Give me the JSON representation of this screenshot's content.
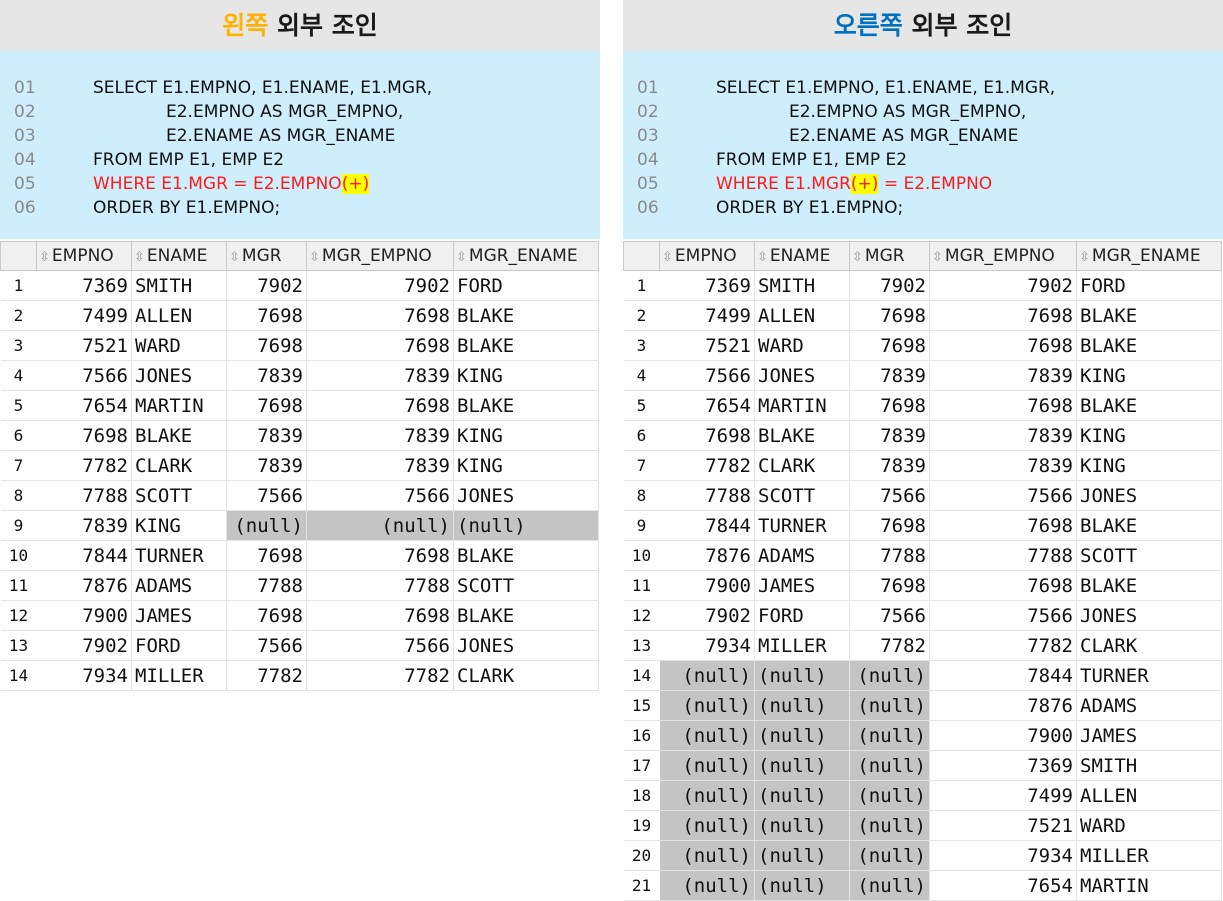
{
  "left": {
    "title_highlight": "왼쪽",
    "title_rest": " 외부 조인",
    "title_color": "#ffb100",
    "code": [
      {
        "ln": "01",
        "indent": 0,
        "red": false,
        "text": "SELECT E1.EMPNO, E1.ENAME, E1.MGR,",
        "hl": ""
      },
      {
        "ln": "02",
        "indent": 1,
        "red": false,
        "text": "E2.EMPNO AS MGR_EMPNO,",
        "hl": ""
      },
      {
        "ln": "03",
        "indent": 1,
        "red": false,
        "text": "E2.ENAME AS MGR_ENAME",
        "hl": ""
      },
      {
        "ln": "04",
        "indent": 0,
        "red": false,
        "text": "FROM EMP E1, EMP E2",
        "hl": ""
      },
      {
        "ln": "05",
        "indent": 0,
        "red": true,
        "text": "WHERE E1.MGR = E2.EMPNO",
        "hl": "(+)",
        "after": ""
      },
      {
        "ln": "06",
        "indent": 0,
        "red": false,
        "text": "ORDER BY E1.EMPNO;",
        "hl": ""
      }
    ],
    "columns": [
      "EMPNO",
      "ENAME",
      "MGR",
      "MGR_EMPNO",
      "MGR_ENAME"
    ],
    "rows": [
      [
        "1",
        "7369",
        "SMITH",
        "7902",
        "7902",
        "FORD"
      ],
      [
        "2",
        "7499",
        "ALLEN",
        "7698",
        "7698",
        "BLAKE"
      ],
      [
        "3",
        "7521",
        "WARD",
        "7698",
        "7698",
        "BLAKE"
      ],
      [
        "4",
        "7566",
        "JONES",
        "7839",
        "7839",
        "KING"
      ],
      [
        "5",
        "7654",
        "MARTIN",
        "7698",
        "7698",
        "BLAKE"
      ],
      [
        "6",
        "7698",
        "BLAKE",
        "7839",
        "7839",
        "KING"
      ],
      [
        "7",
        "7782",
        "CLARK",
        "7839",
        "7839",
        "KING"
      ],
      [
        "8",
        "7788",
        "SCOTT",
        "7566",
        "7566",
        "JONES"
      ],
      [
        "9",
        "7839",
        "KING",
        "(null)",
        "(null)",
        "(null)"
      ],
      [
        "10",
        "7844",
        "TURNER",
        "7698",
        "7698",
        "BLAKE"
      ],
      [
        "11",
        "7876",
        "ADAMS",
        "7788",
        "7788",
        "SCOTT"
      ],
      [
        "12",
        "7900",
        "JAMES",
        "7698",
        "7698",
        "BLAKE"
      ],
      [
        "13",
        "7902",
        "FORD",
        "7566",
        "7566",
        "JONES"
      ],
      [
        "14",
        "7934",
        "MILLER",
        "7782",
        "7782",
        "CLARK"
      ]
    ]
  },
  "right": {
    "title_highlight": "오른쪽",
    "title_rest": " 외부 조인",
    "title_color": "#0070c0",
    "code": [
      {
        "ln": "01",
        "indent": 0,
        "red": false,
        "text": "SELECT E1.EMPNO, E1.ENAME, E1.MGR,",
        "hl": ""
      },
      {
        "ln": "02",
        "indent": 1,
        "red": false,
        "text": "E2.EMPNO AS MGR_EMPNO,",
        "hl": ""
      },
      {
        "ln": "03",
        "indent": 1,
        "red": false,
        "text": "E2.ENAME AS MGR_ENAME",
        "hl": ""
      },
      {
        "ln": "04",
        "indent": 0,
        "red": false,
        "text": "FROM EMP E1, EMP E2",
        "hl": ""
      },
      {
        "ln": "05",
        "indent": 0,
        "red": true,
        "text": "WHERE E1.MGR",
        "hl": "(+)",
        "after": " = E2.EMPNO"
      },
      {
        "ln": "06",
        "indent": 0,
        "red": false,
        "text": "ORDER BY E1.EMPNO;",
        "hl": ""
      }
    ],
    "columns": [
      "EMPNO",
      "ENAME",
      "MGR",
      "MGR_EMPNO",
      "MGR_ENAME"
    ],
    "rows": [
      [
        "1",
        "7369",
        "SMITH",
        "7902",
        "7902",
        "FORD"
      ],
      [
        "2",
        "7499",
        "ALLEN",
        "7698",
        "7698",
        "BLAKE"
      ],
      [
        "3",
        "7521",
        "WARD",
        "7698",
        "7698",
        "BLAKE"
      ],
      [
        "4",
        "7566",
        "JONES",
        "7839",
        "7839",
        "KING"
      ],
      [
        "5",
        "7654",
        "MARTIN",
        "7698",
        "7698",
        "BLAKE"
      ],
      [
        "6",
        "7698",
        "BLAKE",
        "7839",
        "7839",
        "KING"
      ],
      [
        "7",
        "7782",
        "CLARK",
        "7839",
        "7839",
        "KING"
      ],
      [
        "8",
        "7788",
        "SCOTT",
        "7566",
        "7566",
        "JONES"
      ],
      [
        "9",
        "7844",
        "TURNER",
        "7698",
        "7698",
        "BLAKE"
      ],
      [
        "10",
        "7876",
        "ADAMS",
        "7788",
        "7788",
        "SCOTT"
      ],
      [
        "11",
        "7900",
        "JAMES",
        "7698",
        "7698",
        "BLAKE"
      ],
      [
        "12",
        "7902",
        "FORD",
        "7566",
        "7566",
        "JONES"
      ],
      [
        "13",
        "7934",
        "MILLER",
        "7782",
        "7782",
        "CLARK"
      ],
      [
        "14",
        "(null)",
        "(null)",
        "(null)",
        "7844",
        "TURNER"
      ],
      [
        "15",
        "(null)",
        "(null)",
        "(null)",
        "7876",
        "ADAMS"
      ],
      [
        "16",
        "(null)",
        "(null)",
        "(null)",
        "7900",
        "JAMES"
      ],
      [
        "17",
        "(null)",
        "(null)",
        "(null)",
        "7369",
        "SMITH"
      ],
      [
        "18",
        "(null)",
        "(null)",
        "(null)",
        "7499",
        "ALLEN"
      ],
      [
        "19",
        "(null)",
        "(null)",
        "(null)",
        "7521",
        "WARD"
      ],
      [
        "20",
        "(null)",
        "(null)",
        "(null)",
        "7934",
        "MILLER"
      ],
      [
        "21",
        "(null)",
        "(null)",
        "(null)",
        "7654",
        "MARTIN"
      ]
    ]
  },
  "icons": {
    "sort": "sort-arrows-icon",
    "sort_glyph": "⇳"
  }
}
